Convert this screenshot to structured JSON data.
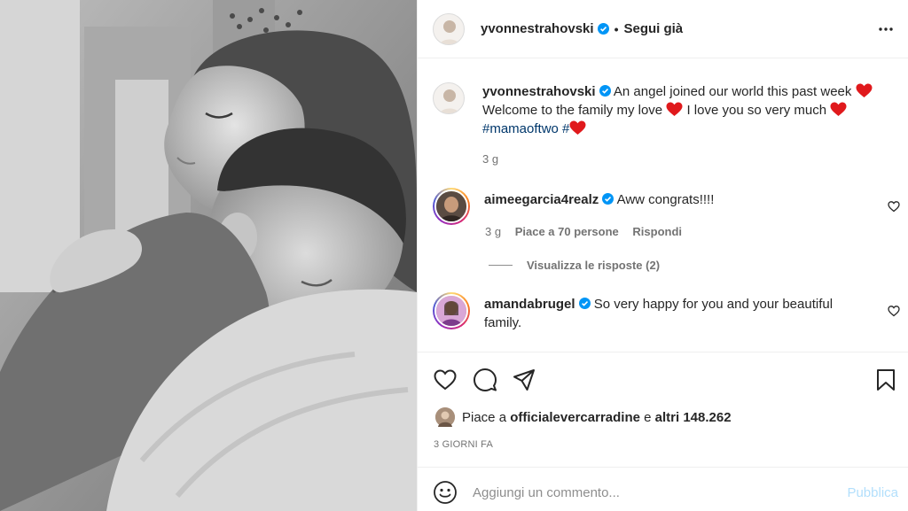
{
  "post": {
    "photo_alt": "",
    "colors": {
      "verified": "#0095f6",
      "heart": "#e0191c",
      "hashtag": "#00376b",
      "publish_disabled": "#b2dffc"
    }
  },
  "header": {
    "username": "yvonnestrahovski",
    "separator": "•",
    "follow_status": "Segui già",
    "more_icon": "more-horizontal-icon"
  },
  "caption": {
    "username": "yvonnestrahovski",
    "line1": "An angel joined our world this past week",
    "line2a": "Welcome to the family my love",
    "line2b": "I love you so very much",
    "hashtag": "#mamaoftwo",
    "hash2": "#",
    "time": "3 g"
  },
  "comments": [
    {
      "username": "aimeegarcia4realz",
      "text": "Aww congrats!!!!",
      "time": "3 g",
      "likes": "Piace a 70 persone",
      "reply": "Rispondi",
      "view_replies": "Visualizza le risposte (2)"
    },
    {
      "username": "amandabrugel",
      "text_line1": "So very happy for you and your beautiful",
      "text_line2": "family."
    }
  ],
  "actions": {
    "icons": [
      "heart-icon",
      "comment-icon",
      "share-icon",
      "bookmark-icon"
    ]
  },
  "likes": {
    "prefix": "Piace a",
    "user": "officialevercarradine",
    "joiner": "e",
    "others": "altri 148.262"
  },
  "date": "3 GIORNI FA",
  "composer": {
    "placeholder": "Aggiungi un commento...",
    "publish": "Pubblica"
  }
}
